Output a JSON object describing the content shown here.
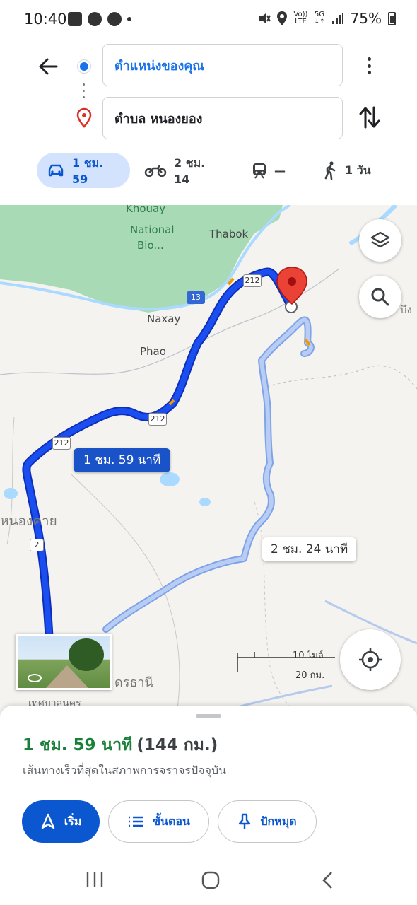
{
  "status_bar": {
    "time": "10:40",
    "battery": "75%",
    "network": "5G",
    "lte_top": "Vo))",
    "lte_bottom": "LTE"
  },
  "directions": {
    "origin": "ตำแหน่งของคุณ",
    "destination": "ตำบล หนองยอง"
  },
  "modes": [
    {
      "name": "drive",
      "label": "1 ชม. 59",
      "active": true
    },
    {
      "name": "motorcycle",
      "label": "2 ชม. 14",
      "active": false
    },
    {
      "name": "transit",
      "label": "—",
      "active": false
    },
    {
      "name": "walk",
      "label": "1 วัน",
      "active": false
    }
  ],
  "map": {
    "labels": {
      "khouay": "Khouay",
      "national": "National",
      "bio": "Bio...",
      "thabok": "Thabok",
      "naxay": "Naxay",
      "phao": "Phao",
      "nongkhai": "หนองคาย",
      "udon": "ดรธานี",
      "thesaban": "เทศบาลนคร",
      "bueng": "บึง"
    },
    "shields": {
      "r13": "13",
      "r212_a": "212",
      "r212_b": "212",
      "r212_c": "212",
      "r2": "2"
    },
    "route_main_time": "1 ชม. 59 นาที",
    "route_alt_time": "2 ชม. 24 นาที",
    "scale_top": "10 ไมล์",
    "scale_bottom": "20 กม."
  },
  "summary": {
    "time": "1 ชม. 59 นาที",
    "distance": "(144 กม.)",
    "description": "เส้นทางเร็วที่สุดในสภาพการจราจรปัจจุบัน"
  },
  "actions": {
    "start": "เริ่ม",
    "steps": "ขั้นตอน",
    "pin": "ปักหมุด"
  },
  "colors": {
    "primary": "#0b57d0",
    "route_main": "#1a3ee8",
    "route_alt": "#a9bdf0",
    "time_green": "#188038",
    "park": "#a8dab5"
  }
}
